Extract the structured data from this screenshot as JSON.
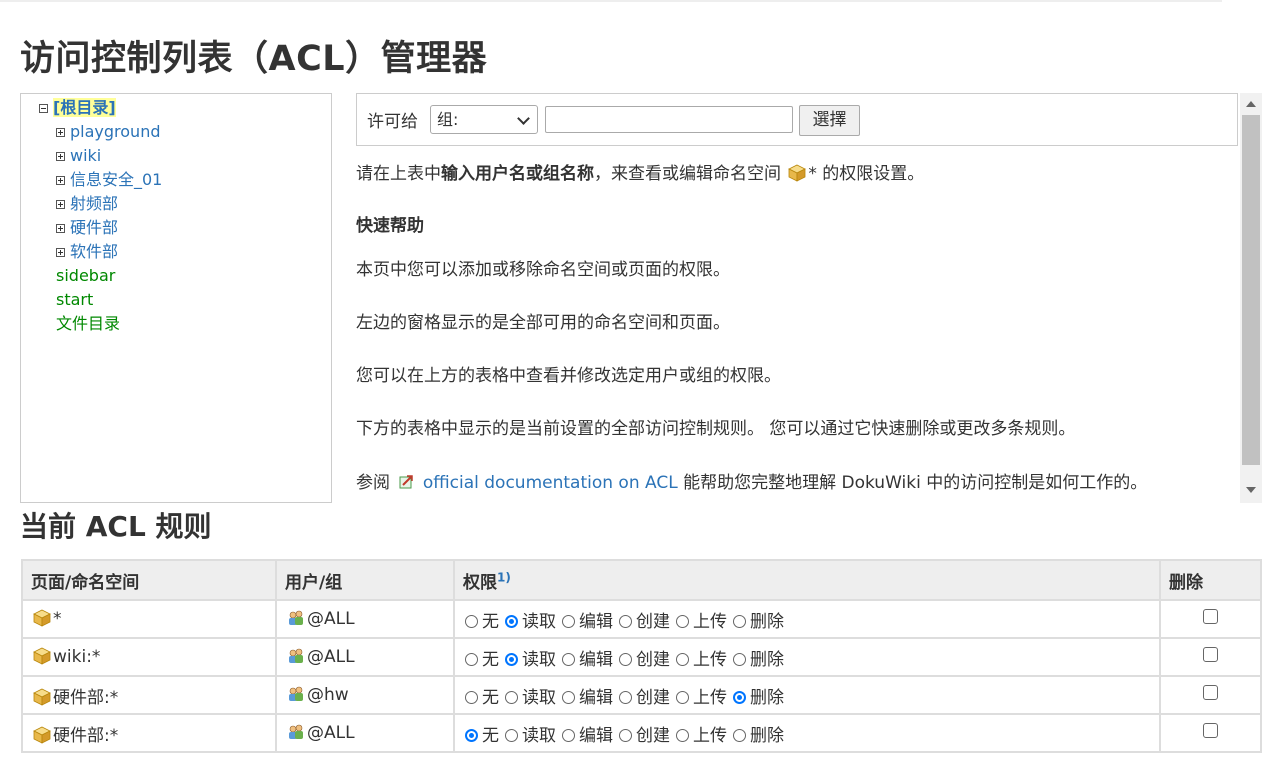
{
  "page": {
    "title": "访问控制列表（ACL）管理器",
    "rules_heading": "当前 ACL 规则"
  },
  "tree": {
    "root": "[根目录]",
    "namespaces": [
      "playground",
      "wiki",
      "信息安全_01",
      "射频部",
      "硬件部",
      "软件部"
    ],
    "pages": [
      "sidebar",
      "start",
      "文件目录"
    ]
  },
  "form": {
    "label": "许可给",
    "select_value": "组:",
    "input_value": "",
    "button_label": "選擇"
  },
  "help": {
    "intro_before": "请在上表中",
    "intro_bold": "输入用户名或组名称",
    "intro_after": "，来查看或编辑命名空间",
    "intro_ns": "*",
    "intro_end": " 的权限设置。",
    "heading": "快速帮助",
    "p1": "本页中您可以添加或移除命名空间或页面的权限。",
    "p2": "左边的窗格显示的是全部可用的命名空间和页面。",
    "p3": "您可以在上方的表格中查看并修改选定用户或组的权限。",
    "p4": "下方的表格中显示的是当前设置的全部访问控制规则。 您可以通过它快速删除或更改多条规则。",
    "p5_before": "参阅",
    "p5_link": "official documentation on ACL",
    "p5_after": "能帮助您完整地理解 DokuWiki 中的访问控制是如何工作的。"
  },
  "table": {
    "headers": {
      "page": "页面/命名空间",
      "user": "用户/组",
      "perm": "权限",
      "perm_sup": "1)",
      "delete": "删除"
    },
    "perm_options": [
      "无",
      "读取",
      "编辑",
      "创建",
      "上传",
      "删除"
    ],
    "rows": [
      {
        "page": "*",
        "user": "@ALL",
        "selected": 1,
        "delete_checked": false
      },
      {
        "page": "wiki:*",
        "user": "@ALL",
        "selected": 1,
        "delete_checked": false
      },
      {
        "page": "硬件部:*",
        "user": "@hw",
        "selected": 5,
        "delete_checked": false
      },
      {
        "page": "硬件部:*",
        "user": "@ALL",
        "selected": 0,
        "delete_checked": false
      }
    ]
  },
  "colors": {
    "link": "#2b73b7",
    "page_link": "#008800",
    "root_highlight": "#ffff99",
    "radio_selected": "#0075ff"
  }
}
